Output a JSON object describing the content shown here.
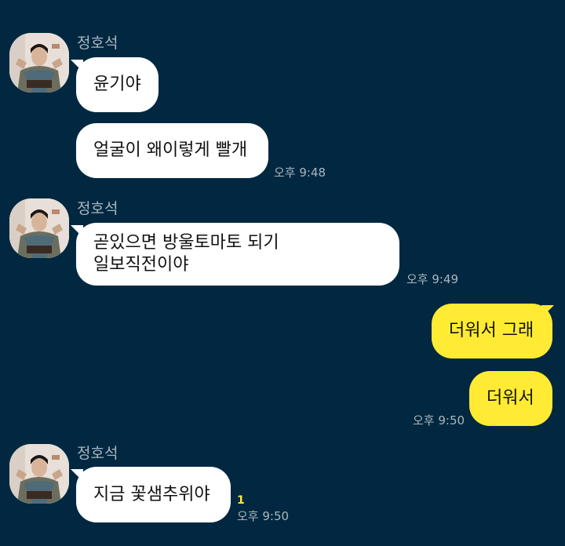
{
  "groups": [
    {
      "sender": "정호석",
      "avatar_icon": "profile-photo",
      "messages": [
        "윤기야",
        "얼굴이 왜이렇게 빨개"
      ],
      "time": "오후 9:48"
    },
    {
      "sender": "정호석",
      "avatar_icon": "profile-photo",
      "messages": [
        [
          "곧있으면 방울토마토 되기",
          "일보직전이야"
        ]
      ],
      "time": "오후 9:49"
    },
    {
      "sender": "me",
      "messages": [
        "더워서 그래",
        "더워서"
      ],
      "time": "오후 9:50"
    },
    {
      "sender": "정호석",
      "avatar_icon": "profile-photo",
      "messages": [
        "지금 꽃샘추위야"
      ],
      "unread_count": "1",
      "time": "오후 9:50"
    }
  ],
  "colors": {
    "background": "#012840",
    "incoming_bubble": "#ffffff",
    "outgoing_bubble": "#ffeb33",
    "meta_text": "#a9b6c0",
    "unread": "#ffeb33"
  }
}
